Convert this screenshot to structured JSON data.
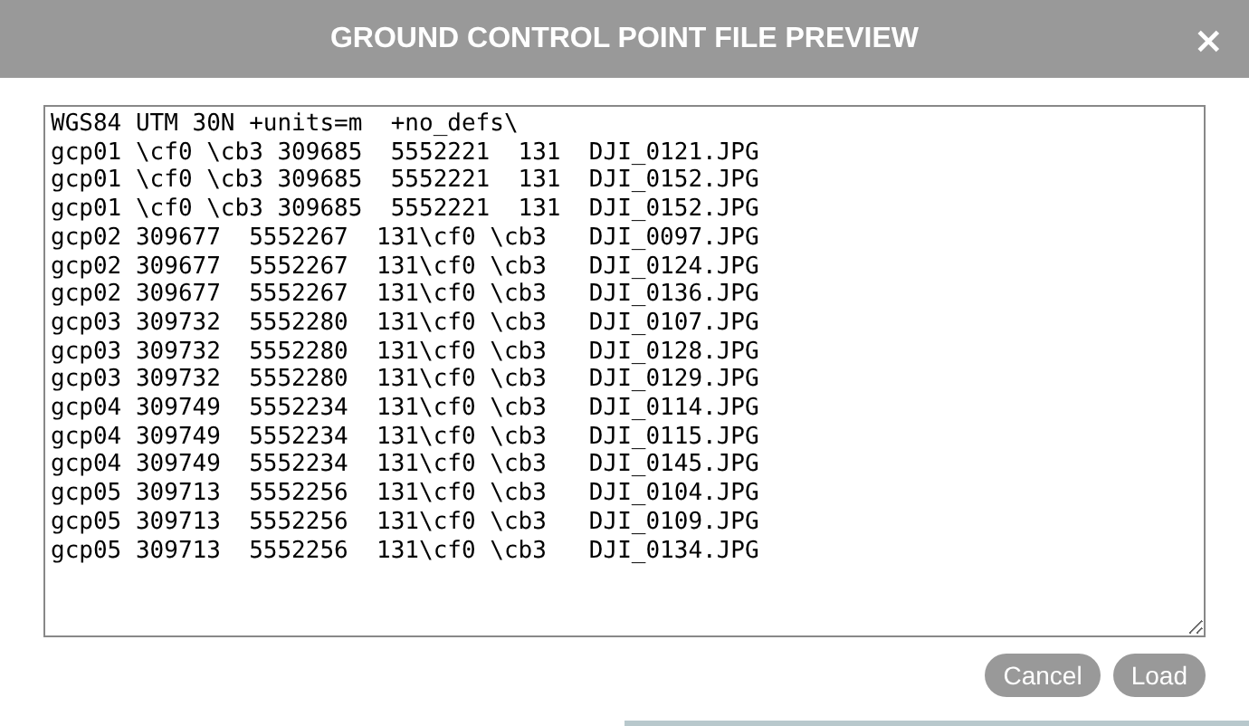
{
  "dialog": {
    "title": "GROUND CONTROL POINT FILE PREVIEW",
    "close": "×"
  },
  "preview": {
    "lines": [
      "WGS84 UTM 30N +units=m  +no_defs\\",
      "gcp01 \\cf0 \\cb3 309685  5552221  131  DJI_0121.JPG",
      "gcp01 \\cf0 \\cb3 309685  5552221  131  DJI_0152.JPG",
      "gcp01 \\cf0 \\cb3 309685  5552221  131  DJI_0152.JPG",
      "gcp02 309677  5552267  131\\cf0 \\cb3   DJI_0097.JPG",
      "gcp02 309677  5552267  131\\cf0 \\cb3   DJI_0124.JPG",
      "gcp02 309677  5552267  131\\cf0 \\cb3   DJI_0136.JPG",
      "gcp03 309732  5552280  131\\cf0 \\cb3   DJI_0107.JPG",
      "gcp03 309732  5552280  131\\cf0 \\cb3   DJI_0128.JPG",
      "gcp03 309732  5552280  131\\cf0 \\cb3   DJI_0129.JPG",
      "gcp04 309749  5552234  131\\cf0 \\cb3   DJI_0114.JPG",
      "gcp04 309749  5552234  131\\cf0 \\cb3   DJI_0115.JPG",
      "gcp04 309749  5552234  131\\cf0 \\cb3   DJI_0145.JPG",
      "gcp05 309713  5552256  131\\cf0 \\cb3   DJI_0104.JPG",
      "gcp05 309713  5552256  131\\cf0 \\cb3   DJI_0109.JPG",
      "gcp05 309713  5552256  131\\cf0 \\cb3   DJI_0134.JPG"
    ]
  },
  "buttons": [
    {
      "label": "Cancel"
    },
    {
      "label": "Load"
    }
  ]
}
